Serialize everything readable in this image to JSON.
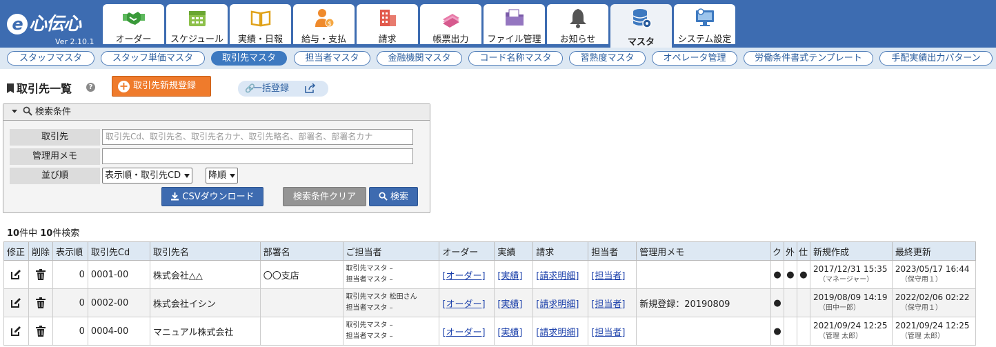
{
  "app": {
    "logo_text": "心伝心",
    "logo_e": "e",
    "version": "Ver 2.10.1"
  },
  "main_tabs": [
    {
      "label": "オーダー",
      "icon": "handshake-icon"
    },
    {
      "label": "スケジュール",
      "icon": "calendar-icon"
    },
    {
      "label": "実績・日報",
      "icon": "book-icon"
    },
    {
      "label": "給与・支払",
      "icon": "payroll-person-icon"
    },
    {
      "label": "請求",
      "icon": "building-icon"
    },
    {
      "label": "帳票出力",
      "icon": "documents-icon"
    },
    {
      "label": "ファイル管理",
      "icon": "folder-icon"
    },
    {
      "label": "お知らせ",
      "icon": "bell-icon"
    },
    {
      "label": "マスタ",
      "icon": "database-icon",
      "active": true
    },
    {
      "label": "システム設定",
      "icon": "monitor-gear-icon"
    }
  ],
  "sub_tabs": [
    {
      "label": "スタッフマスタ"
    },
    {
      "label": "スタッフ単価マスタ"
    },
    {
      "label": "取引先マスタ",
      "active": true
    },
    {
      "label": "担当者マスタ"
    },
    {
      "label": "金融機関マスタ"
    },
    {
      "label": "コード名称マスタ"
    },
    {
      "label": "習熟度マスタ"
    },
    {
      "label": "オペレータ管理"
    },
    {
      "label": "労働条件書式テンプレート"
    },
    {
      "label": "手配実績出力パターン"
    }
  ],
  "page": {
    "title": "取引先一覧",
    "help": "?",
    "new_button": "取引先新規登録",
    "new_plus": "+",
    "bulk_button": "一括登録",
    "bulk_link_glyph": "🔗"
  },
  "search": {
    "header": "検索条件",
    "label_client": "取引先",
    "client_placeholder": "取引先Cd、取引先名、取引先名カナ、取引先略名、部署名、部署名カナ",
    "label_memo": "管理用メモ",
    "memo_value": "",
    "label_order": "並び順",
    "order_select": "表示順・取引先CD",
    "direction_select": "降順",
    "csv_button": "CSVダウンロード",
    "clear_button": "検索条件クリア",
    "search_button": "検索"
  },
  "result": {
    "total": "10",
    "total_suffix": "件中",
    "found": "10",
    "found_suffix": "件検索"
  },
  "table": {
    "headers": [
      "修正",
      "削除",
      "表示順",
      "取引先Cd",
      "取引先名",
      "部署名",
      "ご担当者",
      "オーダー",
      "実績",
      "請求",
      "担当者",
      "管理用メモ",
      "ク",
      "外",
      "仕",
      "新規作成",
      "最終更新"
    ],
    "rows": [
      {
        "order": "0",
        "code": "0001-00",
        "name": "株式会社△△",
        "dept": "〇〇支店",
        "contact1": "取引先マスタ –",
        "contact2": "担当者マスタ –",
        "link_order": "[オーダー]",
        "link_result": "[実績]",
        "link_billing": "[請求明細]",
        "link_staff": "[担当者]",
        "memo": "",
        "k": "●",
        "g": "●",
        "s": "●",
        "created": "2017/12/31 15:35",
        "created_by": "（マネージャー）",
        "updated": "2023/05/17 16:44",
        "updated_by": "（保守用１）"
      },
      {
        "order": "0",
        "code": "0002-00",
        "name": "株式会社イシン",
        "dept": "",
        "contact1": "取引先マスタ 松田さん",
        "contact2": "担当者マスタ –",
        "link_order": "[オーダー]",
        "link_result": "[実績]",
        "link_billing": "[請求明細]",
        "link_staff": "[担当者]",
        "memo": "新規登録：20190809",
        "k": "●",
        "g": "",
        "s": "",
        "created": "2019/08/09 14:19",
        "created_by": "（田中一郎）",
        "updated": "2022/02/06 02:22",
        "updated_by": "（保守用１）"
      },
      {
        "order": "0",
        "code": "0004-00",
        "name": "マニュアル株式会社",
        "dept": "",
        "contact1": "取引先マスタ –",
        "contact2": "担当者マスタ –",
        "link_order": "[オーダー]",
        "link_result": "[実績]",
        "link_billing": "[請求明細]",
        "link_staff": "[担当者]",
        "memo": "",
        "k": "●",
        "g": "",
        "s": "",
        "created": "2021/09/24 12:25",
        "created_by": "（管理 太郎）",
        "updated": "2021/09/24 12:25",
        "updated_by": "（管理 太郎）"
      }
    ]
  },
  "colors": {
    "header_blue": "#3d6cb1",
    "subnav_bg": "#dde8f3",
    "new_button_orange": "#ef7b2c",
    "primary_button": "#3e6bb0",
    "clear_button": "#949494"
  }
}
